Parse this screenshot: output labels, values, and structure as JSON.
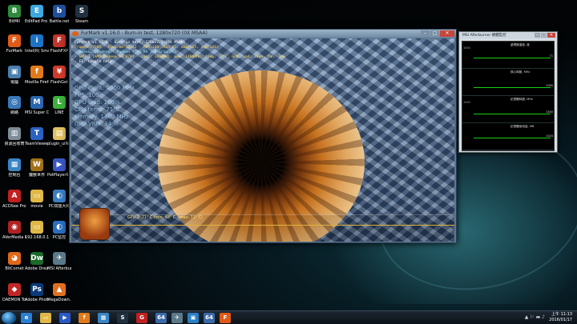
{
  "desktop": {
    "icons": [
      {
        "label": "BitMil",
        "glyph": "B",
        "color": "#2f8a3c"
      },
      {
        "label": "EditPad Pro 7",
        "glyph": "E",
        "color": "#3da8e0"
      },
      {
        "label": "Battle.net",
        "glyph": "b",
        "color": "#1f4f9a"
      },
      {
        "label": "Steam",
        "glyph": "S",
        "color": "#20303e"
      },
      {
        "label": "FurMark",
        "glyph": "F",
        "color": "#e05a18"
      },
      {
        "label": "Intel(R) Small Business A...",
        "glyph": "i",
        "color": "#1d72c4"
      },
      {
        "label": "FlashFXP",
        "glyph": "F",
        "color": "#c0342c"
      },
      {
        "label": "電腦",
        "glyph": "▣",
        "color": "#4b7fb0"
      },
      {
        "label": "Mozilla Firefox",
        "glyph": "f",
        "color": "#e07a1a"
      },
      {
        "label": "FlashGet",
        "glyph": "¥",
        "color": "#d03a2a"
      },
      {
        "label": "網路",
        "glyph": "◎",
        "color": "#3a78b8"
      },
      {
        "label": "MSI Super Charger",
        "glyph": "M",
        "color": "#2a66b0"
      },
      {
        "label": "LINE",
        "glyph": "L",
        "color": "#3cb33a"
      },
      {
        "label": "資源回收筒",
        "glyph": "▥",
        "color": "#7d8c98"
      },
      {
        "label": "TeamViewer 10",
        "glyph": "T",
        "color": "#2a62c2"
      },
      {
        "label": "plugin_uiNuke 10",
        "glyph": "▤",
        "color": "#e0c060"
      },
      {
        "label": "控制台",
        "glyph": "▦",
        "color": "#3a84c4"
      },
      {
        "label": "魔獸世界",
        "glyph": "W",
        "color": "#a07018"
      },
      {
        "label": "PotPlayer6...",
        "glyph": "▶",
        "color": "#3a58c4"
      },
      {
        "label": "ACDSee Pro 5",
        "glyph": "A",
        "color": "#c02020"
      },
      {
        "label": "movie",
        "glyph": "▭",
        "color": "#e0b848"
      },
      {
        "label": "PC效能大師",
        "glyph": "◐",
        "color": "#3a7ec4"
      },
      {
        "label": "AVerMedia RECentral",
        "glyph": "◉",
        "color": "#b02222"
      },
      {
        "label": "192.168.0.1",
        "glyph": "▭",
        "color": "#e0b848"
      },
      {
        "label": "PC監控",
        "glyph": "◐",
        "color": "#2a6ec0"
      },
      {
        "label": "BitComet",
        "glyph": "◕",
        "color": "#e06818"
      },
      {
        "label": "Adobe Dreamweav...",
        "glyph": "Dw",
        "color": "#1a6a2a"
      },
      {
        "label": "MSI Afterburner",
        "glyph": "✈",
        "color": "#5a7a8a"
      },
      {
        "label": "DAEMON Tools Pro",
        "glyph": "◆",
        "color": "#c02828"
      },
      {
        "label": "Adobe Photosho...",
        "glyph": "Ps",
        "color": "#0a3a78"
      },
      {
        "label": "MegaDown...",
        "glyph": "▲",
        "color": "#e07020"
      }
    ]
  },
  "furmark": {
    "title": "FurMark v1.16.0 - Burn-in test, 1280x720 (0X MSAA)",
    "info": {
      "line1": "FurMark v1.16.0 - Burn-in test, 1280x720 (0X MSAA)",
      "line2": "Frames:77005 - time:00:12:42 - FPS:100 (min:81, max:105, avg:100)",
      "line3": "- OpenGL renderer: Radeon (TM) R9 370 Graphics",
      "line4": "- GPU 1 (AMD Radeon R9 370) - core: 1000MHz, mem: 1400MHz, temp: 71°C, GPU load: 100%, fan: 34%",
      "line5": "- F1: toggle help"
    },
    "overlay": [
      "GPU clock: 1000 MHz",
      "FPS: 100",
      "GPU load: 100%",
      "CPU temp: 71°C",
      "Memory: 1400 MHz",
      "GPU VRM: 34 %"
    ],
    "graph_label": "GPU 1: 71° C (min: 48° C - max: 71° C)"
  },
  "afterburner": {
    "title": "MSI Afterburner 硬體監控",
    "graphs": [
      {
        "name": "處理器溫度, 度",
        "left": "1000",
        "right": "71",
        "level": 0.45
      },
      {
        "name": "核心時脈, MHz",
        "left": "",
        "right": "1000",
        "level": 0.3
      },
      {
        "name": "記憶體時脈, MHz",
        "left": "1500",
        "right": "1400",
        "level": 0.35
      },
      {
        "name": "記憶體使用量, MB",
        "left": "",
        "right": "1024",
        "level": 0.55
      }
    ]
  },
  "taskbar": {
    "apps": [
      {
        "name": "ie",
        "glyph": "e",
        "color": "#2a7fd4"
      },
      {
        "name": "explorer",
        "glyph": "▭",
        "color": "#e0b848"
      },
      {
        "name": "media",
        "glyph": "▶",
        "color": "#2a58c4"
      },
      {
        "name": "firefox",
        "glyph": "f",
        "color": "#e07a1a"
      },
      {
        "name": "control",
        "glyph": "▦",
        "color": "#3a84c4"
      },
      {
        "name": "steam",
        "glyph": "S",
        "color": "#20303e"
      },
      {
        "name": "gpu",
        "glyph": "G",
        "color": "#c02020"
      },
      {
        "name": "64bit",
        "glyph": "64",
        "color": "#3a6aa8"
      },
      {
        "name": "afterburner",
        "glyph": "✈",
        "color": "#5a7a8a"
      },
      {
        "name": "monitor",
        "glyph": "▣",
        "color": "#2a7ec4"
      },
      {
        "name": "64bit-2",
        "glyph": "64",
        "color": "#3a6aa8"
      },
      {
        "name": "furmark",
        "glyph": "F",
        "color": "#e05a18"
      }
    ],
    "tray": "▲  ⚐  ▬  ♪",
    "time": "上午 11:13",
    "date": "2016/01/17"
  }
}
